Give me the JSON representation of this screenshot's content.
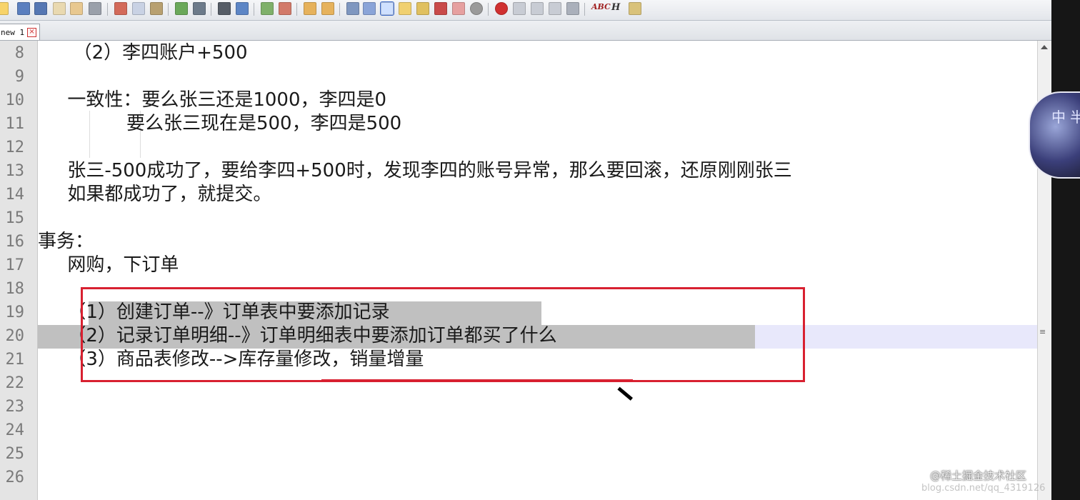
{
  "tab": {
    "label": "new 1",
    "close_glyph": "×"
  },
  "toolbar": {
    "spell_label": "ABC",
    "heading_label": "H"
  },
  "editor": {
    "line_numbers": [
      "8",
      "9",
      "10",
      "11",
      "12",
      "13",
      "14",
      "15",
      "16",
      "17",
      "18",
      "19",
      "20",
      "21",
      "22",
      "23",
      "24",
      "25",
      "26"
    ],
    "lines": [
      "      （2）李四账户+500",
      "",
      "     一致性：要么张三还是1000，李四是0",
      "               要么张三现在是500，李四是500",
      "",
      "     张三-500成功了，要给李四+500时，发现李四的账号异常，那么要回滚，还原刚刚张三",
      "     如果都成功了，就提交。",
      "",
      "事务：",
      "     网购，下订单",
      "",
      "     （1）创建订单--》订单表中要添加记录",
      "     （2）记录订单明细--》订单明细表中要添加订单都买了什么",
      "     （3）商品表修改-->库存量修改，销量增量",
      "",
      "",
      "",
      "",
      ""
    ]
  },
  "overlay": {
    "floating_ball_text": "中半"
  },
  "watermark": {
    "text": "@稀土掘金技术社区",
    "sub": "blog.csdn.net/qq_4319126"
  },
  "colors": {
    "annotation": "#d82030",
    "selection": "#c0c0c0",
    "current_line": "#e8e8fb"
  }
}
